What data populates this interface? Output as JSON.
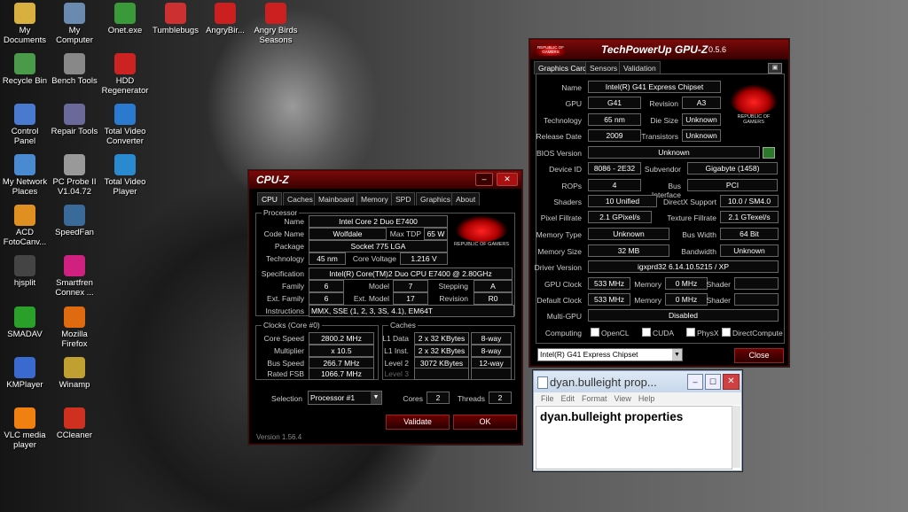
{
  "desktop": {
    "icons": [
      {
        "label": "My Documents",
        "icon": "folder-icon",
        "color": "#d8b040"
      },
      {
        "label": "My Computer",
        "icon": "computer-icon",
        "color": "#6a8ab0"
      },
      {
        "label": "Onet.exe",
        "icon": "onet-icon",
        "color": "#3a9a3a"
      },
      {
        "label": "Tumblebugs",
        "icon": "tumblebugs-icon",
        "color": "#cc3030"
      },
      {
        "label": "AngryBir...",
        "icon": "angry-birds-icon",
        "color": "#cc2020"
      },
      {
        "label": "Angry Birds Seasons",
        "icon": "angry-birds-seasons-icon",
        "color": "#cc2020"
      },
      {
        "label": "Recycle Bin",
        "icon": "recycle-bin-icon",
        "color": "#4a9a4a"
      },
      {
        "label": "Bench Tools",
        "icon": "bench-tools-icon",
        "color": "#888888"
      },
      {
        "label": "HDD Regenerator",
        "icon": "hdd-regenerator-icon",
        "color": "#cc2222"
      },
      {
        "label": "Control Panel",
        "icon": "control-panel-icon",
        "color": "#4a7ad0"
      },
      {
        "label": "Repair Tools",
        "icon": "repair-tools-icon",
        "color": "#6a6a9a"
      },
      {
        "label": "Total Video Converter",
        "icon": "total-video-converter-icon",
        "color": "#2a7ad0"
      },
      {
        "label": "My Network Places",
        "icon": "network-places-icon",
        "color": "#4a8ad0"
      },
      {
        "label": "PC Probe II V1.04.72",
        "icon": "pc-probe-icon",
        "color": "#999999"
      },
      {
        "label": "Total Video Player",
        "icon": "total-video-player-icon",
        "color": "#2a8ad0"
      },
      {
        "label": "ACD FotoCanv...",
        "icon": "acd-fotocanvas-icon",
        "color": "#e09020"
      },
      {
        "label": "SpeedFan",
        "icon": "speedfan-icon",
        "color": "#3a6a9a"
      },
      {
        "label": "hjsplit",
        "icon": "hjsplit-icon",
        "color": "#444444"
      },
      {
        "label": "Smartfren Connex ...",
        "icon": "smartfren-icon",
        "color": "#d02080"
      },
      {
        "label": "SMADAV",
        "icon": "smadav-icon",
        "color": "#2aa02a"
      },
      {
        "label": "Mozilla Firefox",
        "icon": "firefox-icon",
        "color": "#e06a10"
      },
      {
        "label": "KMPlayer",
        "icon": "kmplayer-icon",
        "color": "#3a6ad0"
      },
      {
        "label": "Winamp",
        "icon": "winamp-icon",
        "color": "#c0a030"
      },
      {
        "label": "VLC media player",
        "icon": "vlc-icon",
        "color": "#f08010"
      },
      {
        "label": "CCleaner",
        "icon": "ccleaner-icon",
        "color": "#d03020"
      }
    ]
  },
  "cpuz": {
    "title": "CPU-Z",
    "tabs": [
      "CPU",
      "Caches",
      "Mainboard",
      "Memory",
      "SPD",
      "Graphics",
      "About"
    ],
    "processor_group": "Processor",
    "name_label": "Name",
    "name": "Intel Core 2 Duo E7400",
    "codename_label": "Code Name",
    "codename": "Wolfdale",
    "maxtdp_label": "Max TDP",
    "maxtdp": "65 W",
    "package_label": "Package",
    "package": "Socket 775 LGA",
    "technology_label": "Technology",
    "technology": "45 nm",
    "corevoltage_label": "Core Voltage",
    "corevoltage": "1.216 V",
    "specification_label": "Specification",
    "specification": "Intel(R) Core(TM)2 Duo CPU     E7400  @ 2.80GHz",
    "family_label": "Family",
    "family": "6",
    "model_label": "Model",
    "model": "7",
    "stepping_label": "Stepping",
    "stepping": "A",
    "extfamily_label": "Ext. Family",
    "extfamily": "6",
    "extmodel_label": "Ext. Model",
    "extmodel": "17",
    "revision_label": "Revision",
    "revision": "R0",
    "instructions_label": "Instructions",
    "instructions": "MMX, SSE (1, 2, 3, 3S, 4.1), EM64T",
    "clocks_group": "Clocks (Core #0)",
    "corespeed_label": "Core Speed",
    "corespeed": "2800.2 MHz",
    "multiplier_label": "Multiplier",
    "multiplier": "x 10.5",
    "busspeed_label": "Bus Speed",
    "busspeed": "266.7 MHz",
    "ratedfsb_label": "Rated FSB",
    "ratedfsb": "1066.7 MHz",
    "caches_group": "Caches",
    "l1data_label": "L1 Data",
    "l1data": "2 x 32 KBytes",
    "l1data_way": "8-way",
    "l1inst_label": "L1 Inst.",
    "l1inst": "2 x 32 KBytes",
    "l1inst_way": "8-way",
    "level2_label": "Level 2",
    "level2": "3072 KBytes",
    "level2_way": "12-way",
    "level3_label": "Level 3",
    "selection_label": "Selection",
    "selection": "Processor #1",
    "cores_label": "Cores",
    "cores": "2",
    "threads_label": "Threads",
    "threads": "2",
    "validate": "Validate",
    "ok": "OK",
    "version": "Version 1.56.4",
    "rog_text": "REPUBLIC OF GAMERS"
  },
  "gpuz": {
    "title": "TechPowerUp GPU-Z",
    "version": "0.5.6",
    "rog_text": "REPUBLIC OF GAMERS",
    "tabs": [
      "Graphics Card",
      "Sensors",
      "Validation"
    ],
    "name_label": "Name",
    "name": "Intel(R) G41 Express Chipset",
    "gpu_label": "GPU",
    "gpu": "G41",
    "revision_label": "Revision",
    "revision": "A3",
    "technology_label": "Technology",
    "technology": "65 nm",
    "diesize_label": "Die Size",
    "diesize": "Unknown",
    "releasedate_label": "Release Date",
    "releasedate": "2009",
    "transistors_label": "Transistors",
    "transistors": "Unknown",
    "bios_label": "BIOS Version",
    "bios": "Unknown",
    "deviceid_label": "Device ID",
    "deviceid": "8086 - 2E32",
    "subvendor_label": "Subvendor",
    "subvendor": "Gigabyte (1458)",
    "rops_label": "ROPs",
    "rops": "4",
    "businterface_label": "Bus Interface",
    "businterface": "PCI",
    "shaders_label": "Shaders",
    "shaders": "10 Unified",
    "directx_label": "DirectX Support",
    "directx": "10.0 / SM4.0",
    "pixelfill_label": "Pixel Fillrate",
    "pixelfill": "2.1 GPixel/s",
    "texturefill_label": "Texture Fillrate",
    "texturefill": "2.1 GTexel/s",
    "memtype_label": "Memory Type",
    "memtype": "Unknown",
    "buswidth_label": "Bus Width",
    "buswidth": "64 Bit",
    "memsize_label": "Memory Size",
    "memsize": "32 MB",
    "bandwidth_label": "Bandwidth",
    "bandwidth": "Unknown",
    "driver_label": "Driver Version",
    "driver": "igxprd32 6.14.10.5215 / XP",
    "gpuclock_label": "GPU Clock",
    "gpuclock": "533 MHz",
    "memory_label": "Memory",
    "gpuclock_mem": "0 MHz",
    "shader_label": "Shader",
    "defclock_label": "Default Clock",
    "defclock": "533 MHz",
    "defclock_mem": "0 MHz",
    "multigpu_label": "Multi-GPU",
    "multigpu": "Disabled",
    "computing_label": "Computing",
    "computing_opts": [
      "OpenCL",
      "CUDA",
      "PhysX",
      "DirectCompute"
    ],
    "device_select": "Intel(R) G41 Express Chipset",
    "close": "Close"
  },
  "notepad": {
    "title": "dyan.bulleight prop...",
    "menu": [
      "File",
      "Edit",
      "Format",
      "View",
      "Help"
    ],
    "content": "dyan.bulleight properties"
  }
}
